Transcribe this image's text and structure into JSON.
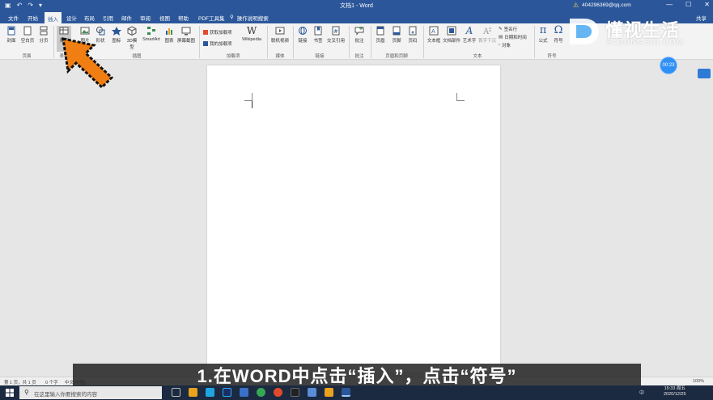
{
  "titlebar": {
    "quick_access": [
      "▣",
      "↶",
      "↷",
      "▾"
    ],
    "title": "文档1 - Word",
    "account": "404296369@qq.com",
    "warn_symbol": "⚠",
    "window_buttons": [
      "—",
      "☐",
      "✕"
    ]
  },
  "tabs": {
    "items": [
      "文件",
      "开始",
      "插入",
      "设计",
      "布局",
      "引用",
      "邮件",
      "审阅",
      "视图",
      "帮助",
      "PDF工具集"
    ],
    "active": 2,
    "tell_me": "操作说明搜索",
    "share": "共享"
  },
  "ribbon": {
    "buttons": [
      {
        "label": "封面",
        "icon": "cover-page-icon"
      },
      {
        "label": "空白页",
        "icon": "blank-page-icon"
      },
      {
        "label": "分页",
        "icon": "page-break-icon"
      },
      {
        "label": "表格",
        "icon": "table-icon"
      },
      {
        "label": "图片",
        "icon": "picture-icon"
      },
      {
        "label": "形状",
        "icon": "shapes-icon"
      },
      {
        "label": "图标",
        "icon": "icons-icon"
      },
      {
        "label": "3D模型",
        "icon": "3d-model-icon"
      },
      {
        "label": "SmartArt",
        "icon": "smartart-icon"
      },
      {
        "label": "图表",
        "icon": "chart-icon"
      },
      {
        "label": "屏幕截图",
        "icon": "screenshot-icon"
      },
      {
        "label": "Wikipedia",
        "icon": "wikipedia-icon"
      },
      {
        "label": "联机视频",
        "icon": "online-video-icon"
      },
      {
        "label": "链接",
        "icon": "link-icon"
      },
      {
        "label": "书签",
        "icon": "bookmark-icon"
      },
      {
        "label": "交叉引用",
        "icon": "cross-ref-icon"
      },
      {
        "label": "批注",
        "icon": "comment-icon"
      },
      {
        "label": "页眉",
        "icon": "header-icon"
      },
      {
        "label": "页脚",
        "icon": "footer-icon"
      },
      {
        "label": "页码",
        "icon": "page-number-icon"
      },
      {
        "label": "文本框",
        "icon": "textbox-icon"
      },
      {
        "label": "文档部件",
        "icon": "quick-parts-icon"
      },
      {
        "label": "艺术字",
        "icon": "wordart-icon"
      },
      {
        "label": "首字下沉",
        "icon": "drop-cap-icon"
      },
      {
        "label": "公式",
        "icon": "equation-icon"
      },
      {
        "label": "符号",
        "icon": "symbol-icon"
      }
    ],
    "addins": [
      "获取加载项",
      "我的加载项"
    ],
    "text_small": [
      "签名行",
      "日期和时间",
      "对象"
    ],
    "groups": [
      "页面",
      "表格",
      "插图",
      "加载项",
      "媒体",
      "链接",
      "批注",
      "页眉和页脚",
      "文本",
      "符号"
    ]
  },
  "logo": {
    "cn": "懂视生活",
    "en": "51DONGSHI.COM"
  },
  "timer": "00:23",
  "statusbar": {
    "page": "第 1 页，共 1 页",
    "words": "0 个字",
    "lang": "中文(中国)",
    "zoom": "100%"
  },
  "caption": "1.在WORD中点击“插入”，点击“符号”",
  "taskbar": {
    "search_placeholder": "在这里输入你要搜索的内容",
    "time": "15:33 周五",
    "date": "2020/12/25",
    "tray": "中",
    "app_colors": [
      "#3a3a3a",
      "#5b8cd6",
      "#1fa5e0",
      "#f5b21a",
      "#3a70c8",
      "#1b7ad8",
      "#36a853",
      "#e34a2b",
      "#222222",
      "#e8a21d",
      "#2b579a"
    ]
  },
  "colors": {
    "word_blue": "#2b579a",
    "arrow": "#f07e12"
  }
}
